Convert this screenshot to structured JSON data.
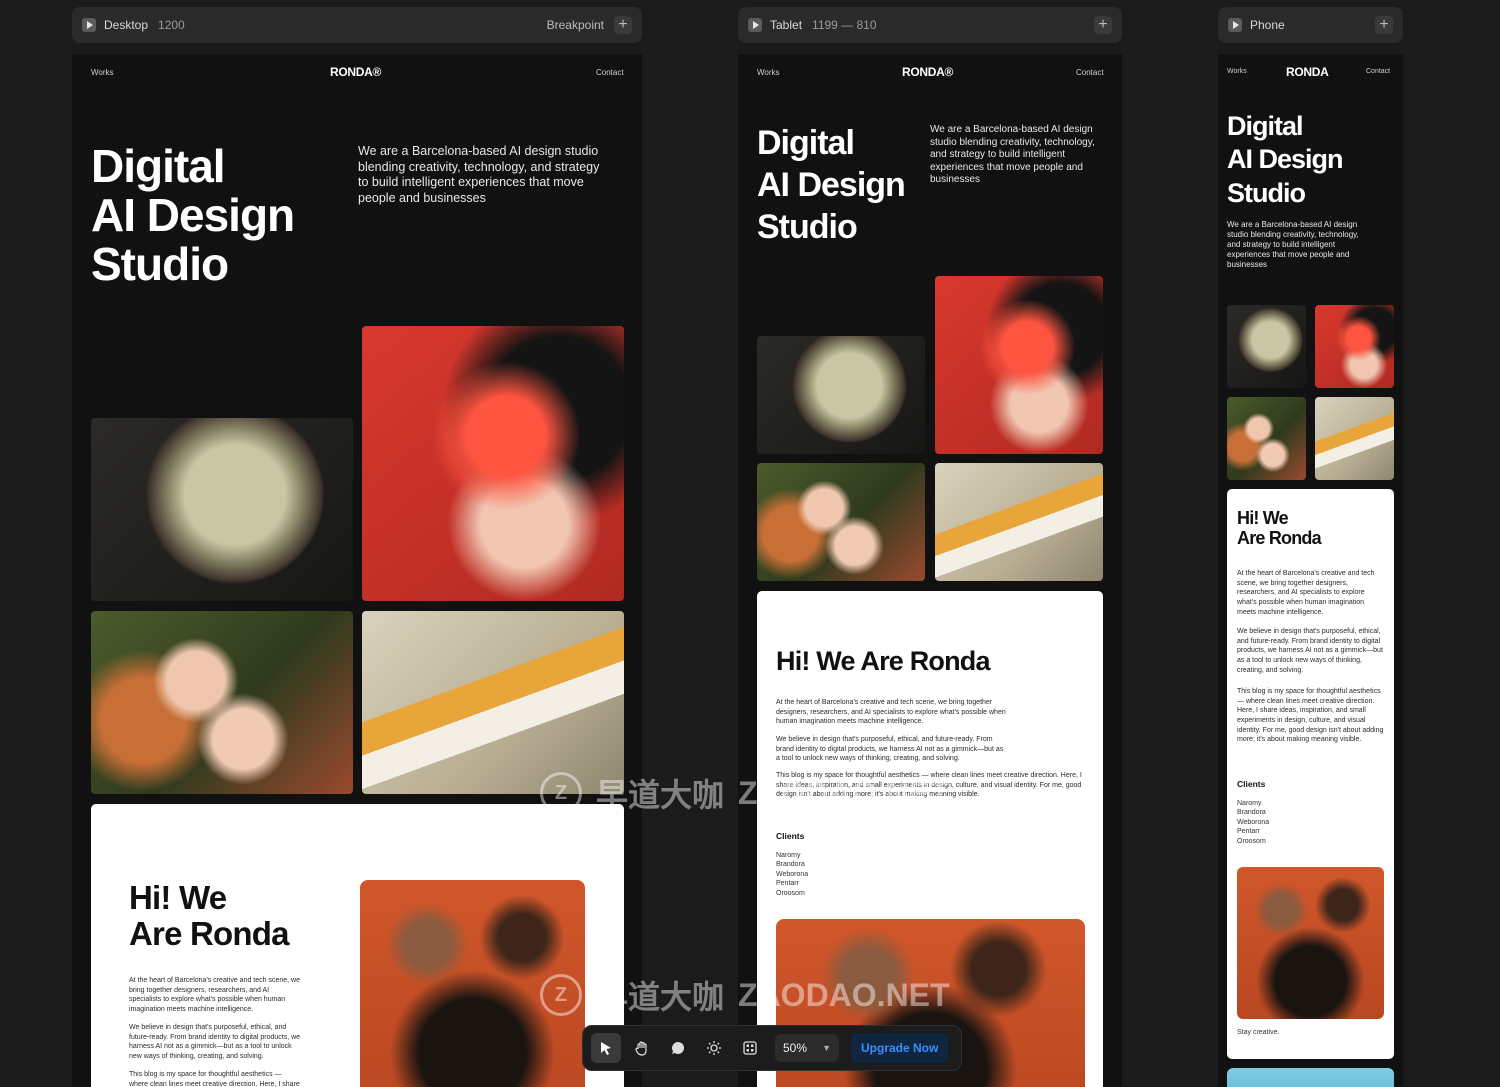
{
  "frames": {
    "desktop": {
      "name": "Desktop",
      "range": "1200",
      "action": "Breakpoint"
    },
    "tablet": {
      "name": "Tablet",
      "range": "1199 — 810"
    },
    "phone": {
      "name": "Phone"
    }
  },
  "site": {
    "nav_left": "Works",
    "logo": "RONDA®",
    "logo_phone": "RONDA",
    "nav_right": "Contact",
    "hero_lines": [
      "Digital",
      "AI Design",
      "Studio"
    ],
    "hero_desc": "We are a Barcelona-based AI design studio blending creativity, technology, and strategy to build intelligent experiences that move people and businesses",
    "about_title": "Hi! We Are Ronda",
    "about_lines": [
      "Hi! We",
      "Are Ronda"
    ],
    "para1": "At the heart of Barcelona's creative and tech scene, we bring together designers, researchers, and AI specialists to explore what's possible when human imagination meets machine intelligence.",
    "para2": "We believe in design that's purposeful, ethical, and future-ready. From brand identity to digital products, we harness AI not as a gimmick—but as a tool to unlock new ways of thinking, creating, and solving.",
    "para3": "This blog is my space for thoughtful aesthetics — where clean lines meet creative direction. Here, I share ideas, inspiration, and small experiments in design, culture, and visual identity. For me, good design isn't about adding more; it's about making meaning visible.",
    "para3_short": "This blog is my space for thoughtful aesthetics — where clean lines meet creative direction. Here, I share",
    "clients_heading": "Clients",
    "clients": [
      "Naromy",
      "Brandora",
      "Weborona",
      "Pentarr",
      "Oroosom"
    ],
    "signoff": "Stay creative."
  },
  "toolbar": {
    "zoom": "50%",
    "upgrade": "Upgrade Now",
    "tools": [
      "pointer-icon",
      "hand-icon",
      "comment-icon",
      "sun-icon",
      "grid-icon"
    ]
  },
  "watermark": {
    "cn": "早道大咖",
    "en": "ZAODAO.NET"
  }
}
